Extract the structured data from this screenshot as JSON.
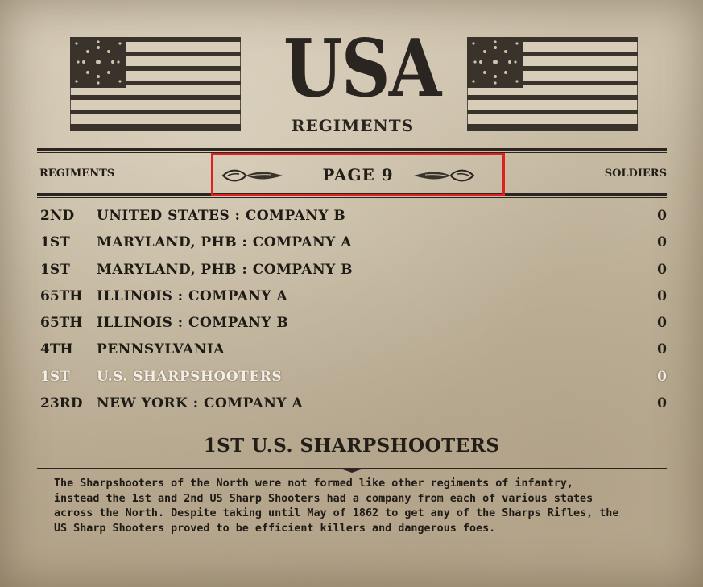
{
  "header": {
    "title": "USA",
    "subtitle": "REGIMENTS"
  },
  "columns": {
    "left": "REGIMENTS",
    "right": "SOLDIERS"
  },
  "pager": {
    "label": "PAGE 9"
  },
  "regiments": [
    {
      "num": "2ND",
      "name": "UNITED STATES : COMPANY B",
      "soldiers": "0",
      "selected": false
    },
    {
      "num": "1ST",
      "name": "MARYLAND, PHB : COMPANY A",
      "soldiers": "0",
      "selected": false
    },
    {
      "num": "1ST",
      "name": "MARYLAND, PHB : COMPANY B",
      "soldiers": "0",
      "selected": false
    },
    {
      "num": "65TH",
      "name": "ILLINOIS : COMPANY A",
      "soldiers": "0",
      "selected": false
    },
    {
      "num": "65TH",
      "name": "ILLINOIS : COMPANY B",
      "soldiers": "0",
      "selected": false
    },
    {
      "num": "4TH",
      "name": "PENNSYLVANIA",
      "soldiers": "0",
      "selected": false
    },
    {
      "num": "1ST",
      "name": "U.S. SHARPSHOOTERS",
      "soldiers": "0",
      "selected": true
    },
    {
      "num": "23RD",
      "name": "NEW YORK : COMPANY A",
      "soldiers": "0",
      "selected": false
    }
  ],
  "detail": {
    "title": "1ST U.S. SHARPSHOOTERS",
    "description_lines": [
      "The Sharpshooters of the North were not formed like other regiments of infantry,",
      "instead the 1st and 2nd US Sharp Shooters had a company from each of various states",
      "across the North. Despite taking until May of 1862 to get any of the Sharps Rifles, the",
      "US Sharp Shooters proved to be efficient killers and dangerous foes."
    ]
  },
  "colors": {
    "paper": "#c9bca6",
    "ink": "#1e1a14",
    "selected_text": "#f4efe6",
    "highlight_box": "#e0201c"
  },
  "icons": {
    "flags": "us-flag-icon",
    "prev": "ornate-arrow-left-icon",
    "next": "ornate-arrow-right-icon"
  }
}
